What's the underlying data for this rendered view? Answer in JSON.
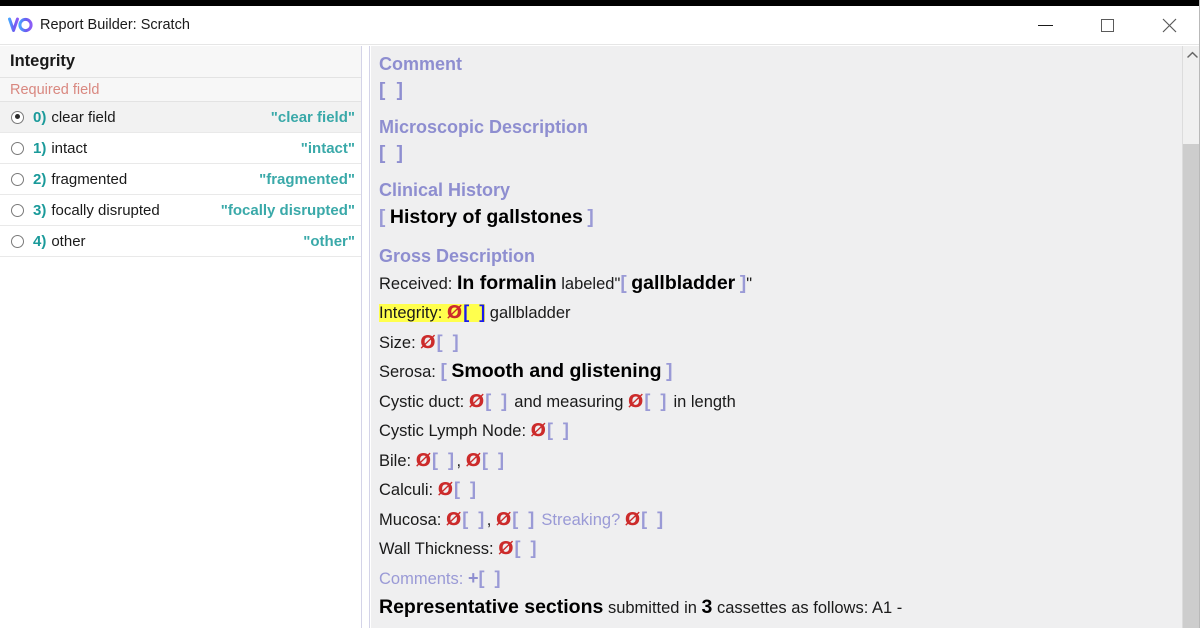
{
  "window": {
    "title": "Report Builder: Scratch",
    "logo_icon": "vo-logo-icon",
    "minimize_icon": "minimize-icon",
    "maximize_icon": "maximize-icon",
    "close_icon": "close-icon"
  },
  "sidebar": {
    "header": "Integrity",
    "required_note": "Required field",
    "options": [
      {
        "index": "0)",
        "label": "clear field",
        "value": "\"clear field\"",
        "selected": true
      },
      {
        "index": "1)",
        "label": "intact",
        "value": "\"intact\"",
        "selected": false
      },
      {
        "index": "2)",
        "label": "fragmented",
        "value": "\"fragmented\"",
        "selected": false
      },
      {
        "index": "3)",
        "label": "focally disrupted",
        "value": "\"focally disrupted\"",
        "selected": false
      },
      {
        "index": "4)",
        "label": "other",
        "value": "\"other\"",
        "selected": false
      }
    ]
  },
  "report": {
    "sections": {
      "comment_heading": "Comment",
      "comment_body": "[  ]",
      "microscopic_heading": "Microscopic Description",
      "microscopic_body": "[  ]",
      "clinical_heading": "Clinical History",
      "clinical_open": "[",
      "clinical_value": "History of gallstones",
      "clinical_close": "]",
      "gross_heading": "Gross Description"
    },
    "lines": {
      "received_label": "Received:",
      "received_value": "In formalin",
      "received_mid": "labeled",
      "received_quote_open": "\"",
      "received_bracket_open": "[",
      "received_specimen": "gallbladder",
      "received_bracket_close": "]",
      "received_quote_close": "\"",
      "integrity_label": "Integrity:",
      "integrity_null": "Ø",
      "integrity_bracket_open": "[",
      "integrity_bracket_close": "]",
      "integrity_suffix": "gallbladder",
      "size_label": "Size:",
      "size_null": "Ø",
      "size_brackets": "[  ]",
      "serosa_label": "Serosa:",
      "serosa_open": "[",
      "serosa_value": "Smooth and glistening",
      "serosa_close": "]",
      "cystic_duct_label": "Cystic duct:",
      "cystic_duct_null_1": "Ø",
      "cystic_duct_brackets_1": "[  ]",
      "cystic_duct_mid": "and measuring",
      "cystic_duct_null_2": "Ø",
      "cystic_duct_brackets_2": "[  ]",
      "cystic_duct_suffix": "in length",
      "cystic_lymph_label": "Cystic Lymph Node:",
      "cystic_lymph_null": "Ø",
      "cystic_lymph_brackets": "[  ]",
      "bile_label": "Bile:",
      "bile_null_1": "Ø",
      "bile_brackets_1": "[  ]",
      "bile_comma": ",",
      "bile_null_2": "Ø",
      "bile_brackets_2": "[  ]",
      "calculi_label": "Calculi:",
      "calculi_null": "Ø",
      "calculi_brackets": "[  ]",
      "mucosa_label": "Mucosa:",
      "mucosa_null_1": "Ø",
      "mucosa_brackets_1": "[  ]",
      "mucosa_comma": ",",
      "mucosa_null_2": "Ø",
      "mucosa_brackets_2": "[  ]",
      "mucosa_streaking": "Streaking?",
      "mucosa_null_3": "Ø",
      "mucosa_brackets_3": "[  ]",
      "wall_label": "Wall Thickness:",
      "wall_null": "Ø",
      "wall_brackets": "[  ]",
      "comments_label": "Comments:",
      "comments_plus": "+",
      "comments_brackets": "[  ]",
      "rep_bold": "Representative sections",
      "rep_mid": "submitted in",
      "rep_count": "3",
      "rep_tail": "cassettes as follows:  A1 -"
    }
  },
  "scrollbar": {
    "up_arrow_icon": "chevron-up-icon"
  },
  "colors": {
    "accent_teal": "#3aa9a9",
    "accent_teal_dark": "#1a9a9a",
    "required_red": "#d98880",
    "section_purple": "#8e8ed0",
    "bracket_purple": "#9a9ad6",
    "bracket_active_blue": "#1a1aee",
    "null_red": "#cc2b2b",
    "highlight_yellow": "#ffff4d",
    "report_bg": "#efeff0"
  }
}
